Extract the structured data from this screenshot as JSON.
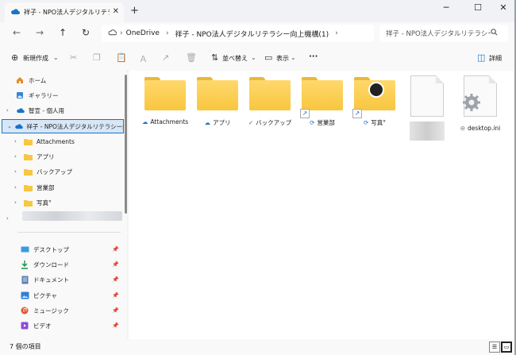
{
  "tab": {
    "title": "祥子 - NPO法人デジタルリテラシー",
    "close": "✕",
    "new": "+"
  },
  "window_controls": {
    "min": "─",
    "max": "☐",
    "close": "✕"
  },
  "nav": {
    "back": "←",
    "forward": "→",
    "up": "↑",
    "refresh": "↻"
  },
  "address": {
    "root": "OneDrive",
    "path": "祥子 - NPO法人デジタルリテラシー向上機構(1)"
  },
  "search": {
    "placeholder": "祥子 - NPO法人デジタルリテラシー向"
  },
  "toolbar": {
    "new_label": "新規作成",
    "sort_label": "並べ替え",
    "view_label": "表示",
    "more_label": "···",
    "details_label": "詳細"
  },
  "sidebar": {
    "items": [
      {
        "label": "ホーム",
        "icon": "home-icon"
      },
      {
        "label": "ギャラリー",
        "icon": "gallery-icon"
      },
      {
        "label": "智宣 - 個人用",
        "icon": "cloud-icon"
      },
      {
        "label": "祥子 - NPO法人デジタルリテラシー向上機",
        "icon": "cloud-icon",
        "selected": true
      },
      {
        "label": "Attachments",
        "icon": "folder-icon"
      },
      {
        "label": "アプリ",
        "icon": "folder-icon"
      },
      {
        "label": "バックアップ",
        "icon": "folder-icon"
      },
      {
        "label": "営業部",
        "icon": "folder-icon"
      },
      {
        "label": "写真°",
        "icon": "folder-icon"
      }
    ],
    "quick": [
      {
        "label": "デスクトップ",
        "icon": "desktop-icon"
      },
      {
        "label": "ダウンロード",
        "icon": "download-icon"
      },
      {
        "label": "ドキュメント",
        "icon": "document-icon"
      },
      {
        "label": "ピクチャ",
        "icon": "picture-icon"
      },
      {
        "label": "ミュージック",
        "icon": "music-icon"
      },
      {
        "label": "ビデオ",
        "icon": "video-icon"
      }
    ]
  },
  "files": [
    {
      "name": "Attachments",
      "type": "folder",
      "status": "cloud"
    },
    {
      "name": "アプリ",
      "type": "folder",
      "status": "cloud"
    },
    {
      "name": "バックアップ",
      "type": "folder",
      "status": "synced"
    },
    {
      "name": "営業部",
      "type": "folder-shortcut",
      "status": "syncing"
    },
    {
      "name": "写真°",
      "type": "folder-shortcut",
      "status": "syncing"
    },
    {
      "name": "",
      "type": "file-blurred",
      "status": ""
    },
    {
      "name": "desktop.ini",
      "type": "settings-file",
      "status": "hidden"
    }
  ],
  "statusbar": {
    "count": "7 個の項目"
  },
  "colors": {
    "accent": "#1a73c8",
    "folder": "#f8c640",
    "selected_bg": "#d8e7f7"
  }
}
